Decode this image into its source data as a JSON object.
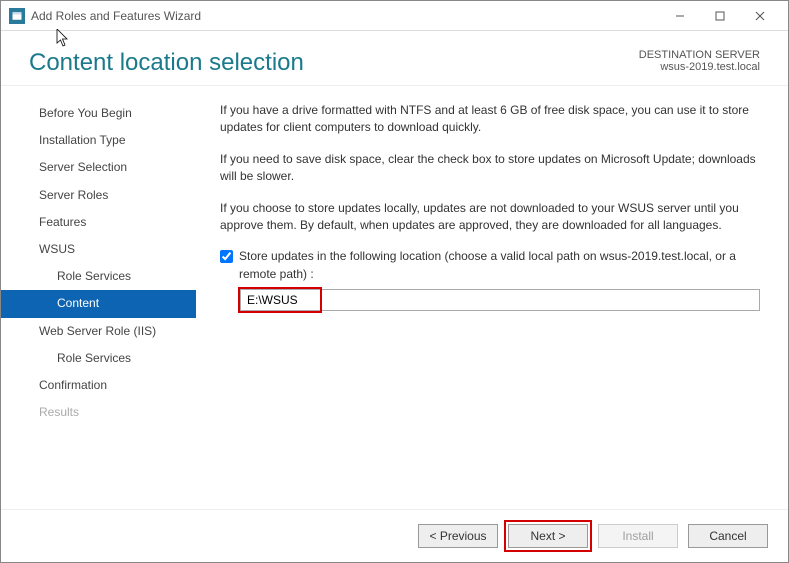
{
  "window": {
    "title": "Add Roles and Features Wizard"
  },
  "header": {
    "title": "Content location selection",
    "destination_label": "DESTINATION SERVER",
    "destination_server": "wsus-2019.test.local"
  },
  "sidebar": {
    "items": [
      {
        "label": "Before You Begin",
        "level": "top"
      },
      {
        "label": "Installation Type",
        "level": "top"
      },
      {
        "label": "Server Selection",
        "level": "top"
      },
      {
        "label": "Server Roles",
        "level": "top"
      },
      {
        "label": "Features",
        "level": "top"
      },
      {
        "label": "WSUS",
        "level": "top"
      },
      {
        "label": "Role Services",
        "level": "sub"
      },
      {
        "label": "Content",
        "level": "sub",
        "selected": true
      },
      {
        "label": "Web Server Role (IIS)",
        "level": "top"
      },
      {
        "label": "Role Services",
        "level": "sub"
      },
      {
        "label": "Confirmation",
        "level": "top"
      },
      {
        "label": "Results",
        "level": "top",
        "disabled": true
      }
    ]
  },
  "content": {
    "para1": "If you have a drive formatted with NTFS and at least 6 GB of free disk space, you can use it to store updates for client computers to download quickly.",
    "para2": "If you need to save disk space, clear the check box to store updates on Microsoft Update; downloads will be slower.",
    "para3": "If you choose to store updates locally, updates are not downloaded to your WSUS server until you approve them. By default, when updates are approved, they are downloaded for all languages.",
    "checkbox_label": "Store updates in the following location (choose a valid local path on wsus-2019.test.local, or a remote path) :",
    "checkbox_checked": true,
    "path_value": "E:\\WSUS"
  },
  "footer": {
    "previous": "< Previous",
    "next": "Next >",
    "install": "Install",
    "cancel": "Cancel"
  }
}
